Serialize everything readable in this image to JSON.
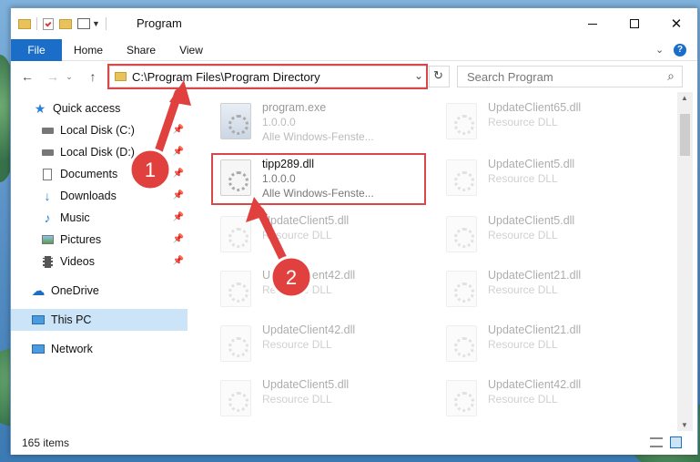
{
  "window": {
    "title": "Program"
  },
  "ribbon": {
    "tabs": [
      {
        "label": "File"
      },
      {
        "label": "Home"
      },
      {
        "label": "Share"
      },
      {
        "label": "View"
      }
    ]
  },
  "address": {
    "path": "C:\\Program Files\\Program Directory"
  },
  "search": {
    "placeholder": "Search Program"
  },
  "sidebar": {
    "items": [
      {
        "label": "Quick access",
        "icon": "star-icon"
      },
      {
        "label": "Local Disk (C:)",
        "icon": "drive-icon"
      },
      {
        "label": "Local Disk (D:)",
        "icon": "drive-icon"
      },
      {
        "label": "Documents",
        "icon": "documents-icon"
      },
      {
        "label": "Downloads",
        "icon": "download-icon"
      },
      {
        "label": "Music",
        "icon": "music-icon"
      },
      {
        "label": "Pictures",
        "icon": "pictures-icon"
      },
      {
        "label": "Videos",
        "icon": "videos-icon"
      },
      {
        "label": "OneDrive",
        "icon": "cloud-icon"
      },
      {
        "label": "This PC",
        "icon": "pc-icon"
      },
      {
        "label": "Network",
        "icon": "network-icon"
      }
    ]
  },
  "files": [
    {
      "name": "program.exe",
      "line2": "1.0.0.0",
      "line3": "Alle Windows-Fenste..."
    },
    {
      "name": "UpdateClient65.dll",
      "line2": "Resource DLL",
      "line3": ""
    },
    {
      "name": "tipp289.dll",
      "line2": "1.0.0.0",
      "line3": "Alle Windows-Fenste..."
    },
    {
      "name": "UpdateClient5.dll",
      "line2": "Resource DLL",
      "line3": ""
    },
    {
      "name": "UpdateClient5.dll",
      "line2": "Resource DLL",
      "line3": ""
    },
    {
      "name": "UpdateClient5.dll",
      "line2": "Resource DLL",
      "line3": ""
    },
    {
      "name": "UpdateClient42.dll",
      "line2": "Resource DLL",
      "line3": ""
    },
    {
      "name": "UpdateClient21.dll",
      "line2": "Resource DLL",
      "line3": ""
    },
    {
      "name": "UpdateClient42.dll",
      "line2": "Resource DLL",
      "line3": ""
    },
    {
      "name": "UpdateClient21.dll",
      "line2": "Resource DLL",
      "line3": ""
    },
    {
      "name": "UpdateClient5.dll",
      "line2": "Resource DLL",
      "line3": ""
    },
    {
      "name": "UpdateClient42.dll",
      "line2": "Resource DLL",
      "line3": ""
    }
  ],
  "status": {
    "items": "165 items"
  },
  "callouts": [
    {
      "number": "1"
    },
    {
      "number": "2"
    }
  ],
  "colors": {
    "accent": "#1a6ec7",
    "highlight": "#d9474a",
    "callout": "#e0413f",
    "selection": "#cce4f7"
  }
}
